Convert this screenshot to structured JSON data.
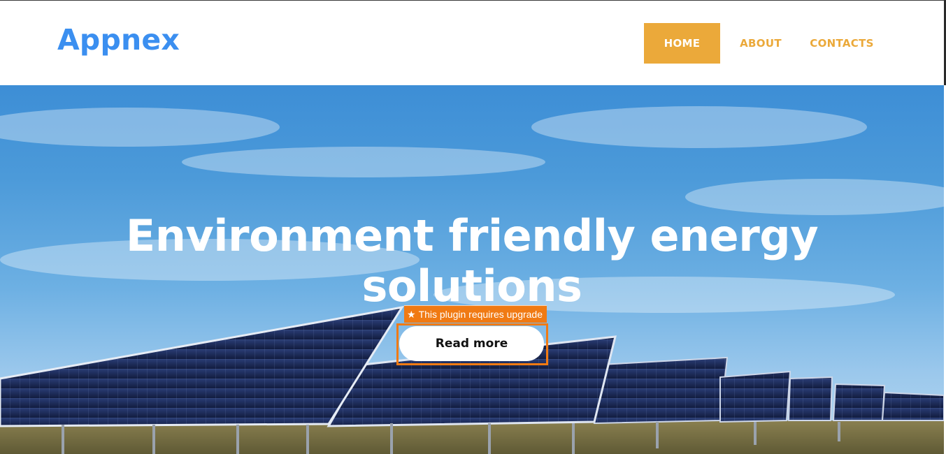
{
  "brand": {
    "name": "Appnex"
  },
  "nav": {
    "home": "HOME",
    "about": "ABOUT",
    "contacts": "CONTACTS"
  },
  "hero": {
    "title_line1": "Environment friendly energy",
    "title_line2": "solutions",
    "upgrade_notice": "This plugin requires upgrade",
    "cta_label": "Read more"
  },
  "colors": {
    "logo": "#3b8ff0",
    "accent": "#eba93a",
    "badge": "#f07a13",
    "sky": "#4c9ad9",
    "panel": "#1c2a55"
  }
}
